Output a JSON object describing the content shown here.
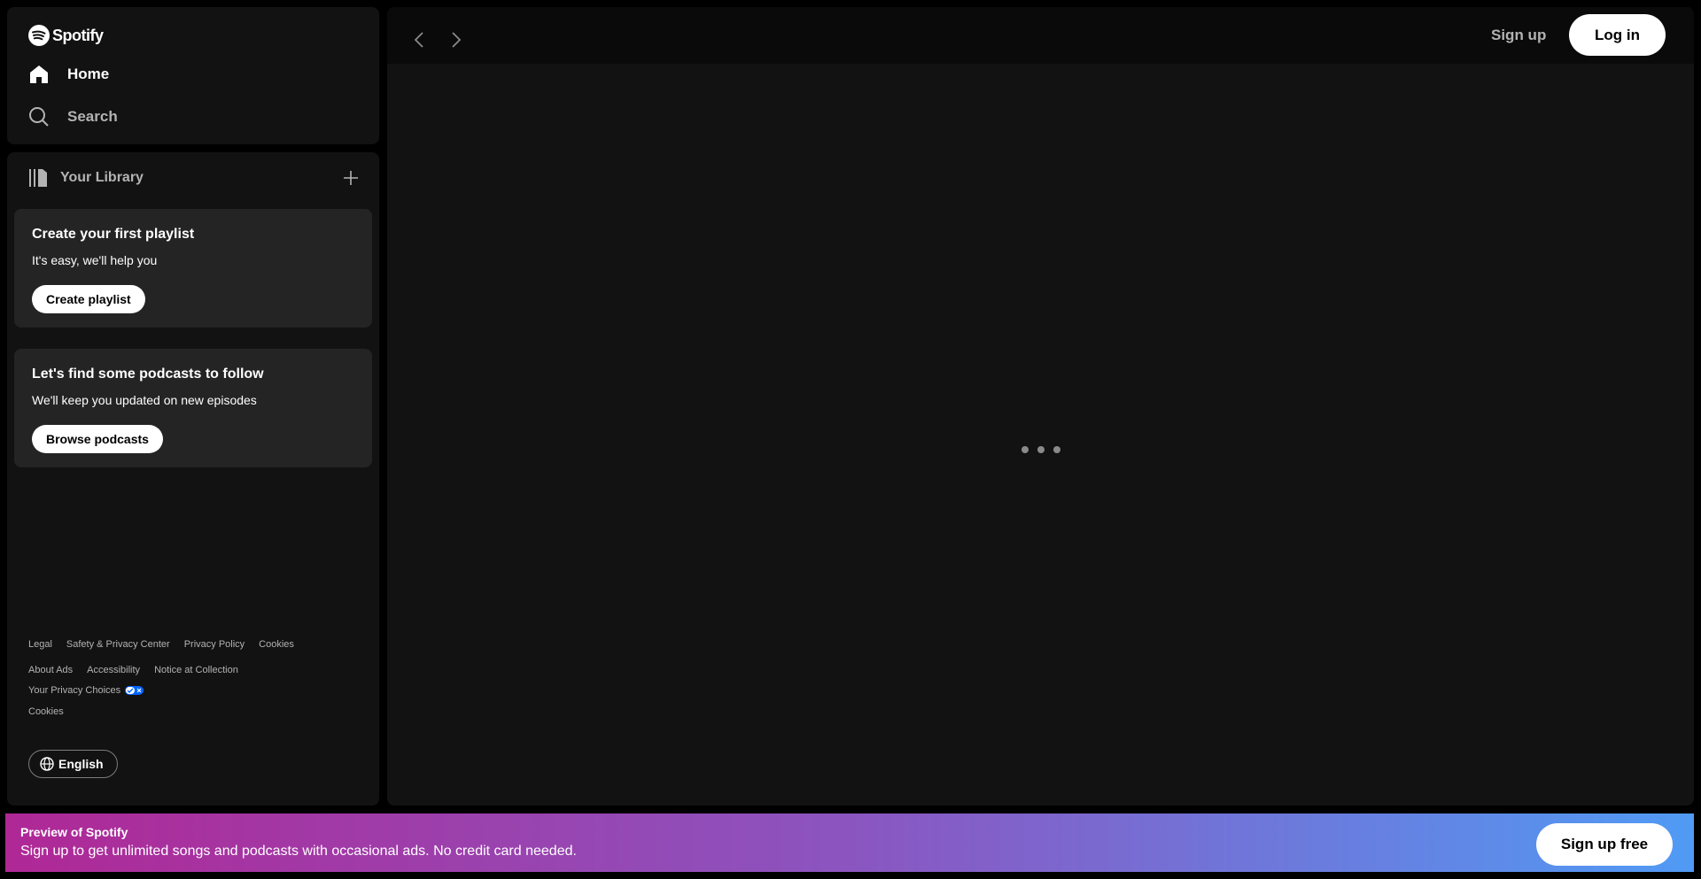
{
  "brand": {
    "name": "Spotify"
  },
  "nav": {
    "items": [
      {
        "label": "Home",
        "icon": "home-icon"
      },
      {
        "label": "Search",
        "icon": "search-icon"
      }
    ]
  },
  "library": {
    "title": "Your Library",
    "add_icon": "plus-icon",
    "cards": [
      {
        "title": "Create your first playlist",
        "subtitle": "It's easy, we'll help you",
        "button": "Create playlist"
      },
      {
        "title": "Let's find some podcasts to follow",
        "subtitle": "We'll keep you updated on new episodes",
        "button": "Browse podcasts"
      }
    ],
    "footer_links": [
      "Legal",
      "Safety & Privacy Center",
      "Privacy Policy",
      "Cookies",
      "About Ads",
      "Accessibility",
      "Notice at Collection",
      "Your Privacy Choices",
      "Cookies"
    ],
    "language": "English"
  },
  "header": {
    "signup": "Sign up",
    "login": "Log in"
  },
  "banner": {
    "title": "Preview of Spotify",
    "text": "Sign up to get unlimited songs and podcasts with occasional ads. No credit card needed.",
    "button": "Sign up free",
    "colors": [
      "#af2896",
      "#509bf5"
    ]
  }
}
